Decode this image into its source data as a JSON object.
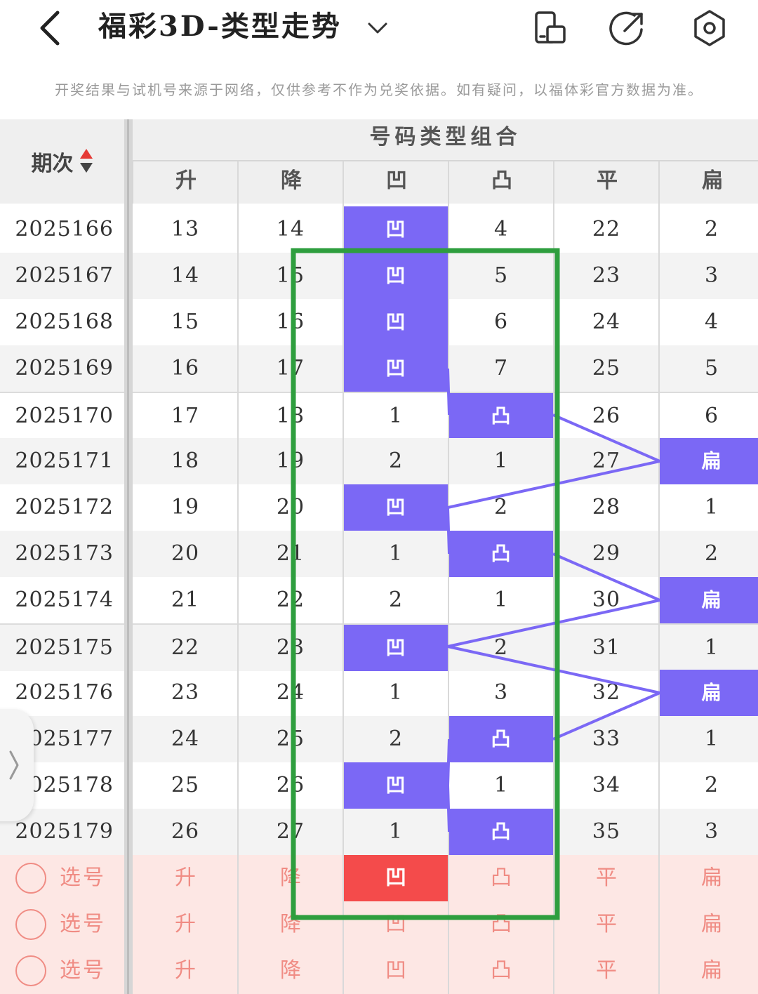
{
  "header": {
    "title": "福彩3D-类型走势"
  },
  "notice": "开奖结果与试机号来源于网络，仅供参考不作为兑奖依据。如有疑问，以福体彩官方数据为准。",
  "table": {
    "period_header": "期次",
    "group_header": "号码类型组合",
    "columns": [
      "升",
      "降",
      "凹",
      "凸",
      "平",
      "扁"
    ],
    "rows": [
      {
        "period": "2025166",
        "v": [
          "13",
          "14",
          "凹",
          "4",
          "22",
          "2"
        ],
        "hl": [
          2
        ]
      },
      {
        "period": "2025167",
        "v": [
          "14",
          "15",
          "凹",
          "5",
          "23",
          "3"
        ],
        "hl": [
          2
        ]
      },
      {
        "period": "2025168",
        "v": [
          "15",
          "16",
          "凹",
          "6",
          "24",
          "4"
        ],
        "hl": [
          2
        ]
      },
      {
        "period": "2025169",
        "v": [
          "16",
          "17",
          "凹",
          "7",
          "25",
          "5"
        ],
        "hl": [
          2
        ]
      },
      {
        "period": "2025170",
        "v": [
          "17",
          "18",
          "1",
          "凸",
          "26",
          "6"
        ],
        "hl": [
          3
        ]
      },
      {
        "period": "2025171",
        "v": [
          "18",
          "19",
          "2",
          "1",
          "27",
          "扁"
        ],
        "hl": [
          5
        ]
      },
      {
        "period": "2025172",
        "v": [
          "19",
          "20",
          "凹",
          "2",
          "28",
          "1"
        ],
        "hl": [
          2
        ]
      },
      {
        "period": "2025173",
        "v": [
          "20",
          "21",
          "1",
          "凸",
          "29",
          "2"
        ],
        "hl": [
          3
        ]
      },
      {
        "period": "2025174",
        "v": [
          "21",
          "22",
          "2",
          "1",
          "30",
          "扁"
        ],
        "hl": [
          5
        ]
      },
      {
        "period": "2025175",
        "v": [
          "22",
          "23",
          "凹",
          "2",
          "31",
          "1"
        ],
        "hl": [
          2
        ]
      },
      {
        "period": "2025176",
        "v": [
          "23",
          "24",
          "1",
          "3",
          "32",
          "扁"
        ],
        "hl": [
          5
        ]
      },
      {
        "period": "2025177",
        "v": [
          "24",
          "25",
          "2",
          "凸",
          "33",
          "1"
        ],
        "hl": [
          3
        ]
      },
      {
        "period": "2025178",
        "v": [
          "25",
          "26",
          "凹",
          "1",
          "34",
          "2"
        ],
        "hl": [
          2
        ]
      },
      {
        "period": "2025179",
        "v": [
          "26",
          "27",
          "1",
          "凸",
          "35",
          "3"
        ],
        "hl": [
          3
        ]
      }
    ]
  },
  "selection": {
    "label": "选号",
    "rows": [
      {
        "v": [
          "升",
          "降",
          "凹",
          "凸",
          "平",
          "扁"
        ],
        "selected": [
          2
        ]
      },
      {
        "v": [
          "升",
          "降",
          "凹",
          "凸",
          "平",
          "扁"
        ],
        "selected": []
      },
      {
        "v": [
          "升",
          "降",
          "凹",
          "凸",
          "平",
          "扁"
        ],
        "selected": []
      }
    ]
  },
  "colors": {
    "highlight": "#7b68f5",
    "selected": "#f44b4b",
    "annotation_box": "#2e9e3e",
    "selection_bg": "#fde7e4",
    "selection_text": "#f08c84"
  },
  "icons": [
    "back-arrow-icon",
    "chevron-down-icon",
    "split-screen-icon",
    "share-icon",
    "settings-icon",
    "chevron-right-icon"
  ]
}
